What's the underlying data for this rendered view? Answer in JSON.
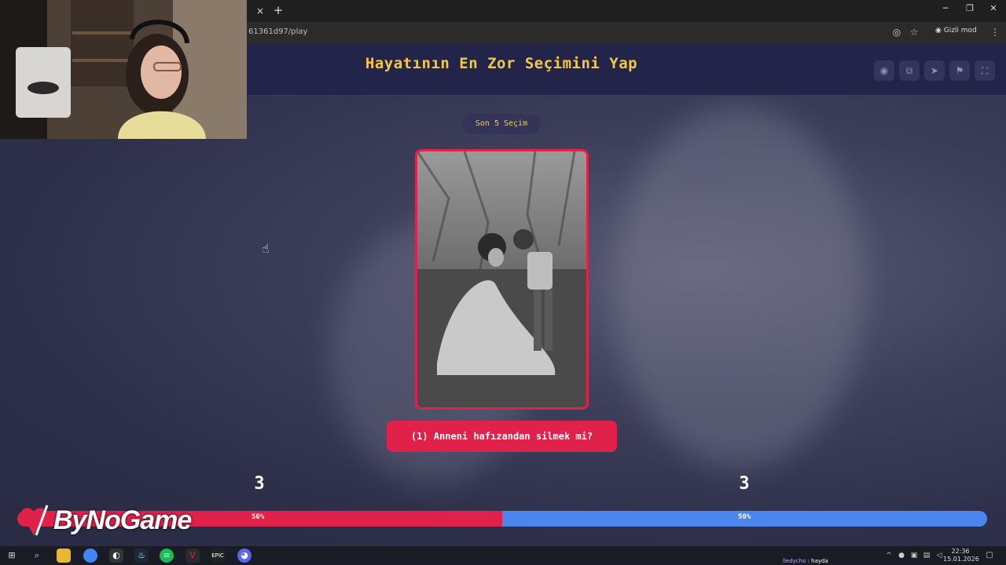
{
  "browser": {
    "tab_close": "×",
    "new_tab": "+",
    "url": "61361d97/play",
    "incognito_label": "Gizli mod",
    "minimize": "─",
    "restore": "❐",
    "close": "✕"
  },
  "site": {
    "title": "Hayatının En Zor Seçimini Yap",
    "header_buttons": [
      "eye-icon",
      "copy-icon",
      "send-icon",
      "flag-icon",
      "fullscreen-icon"
    ],
    "pill_label": "Son 5 Seçim",
    "question": "(1) Anneni hafızandan silmek mi?",
    "left_count": "3",
    "right_count": "3",
    "left_percent": "50%",
    "right_percent": "50%",
    "left_fraction": 0.5,
    "colors": {
      "title": "#f5c842",
      "accent_red": "#e0214a",
      "accent_blue": "#4a86ee",
      "background": "#2a2b45"
    }
  },
  "overlay": {
    "brand": "ByNoGame"
  },
  "taskbar": {
    "chat_user": "lledycho",
    "chat_message": "hayda",
    "time": "22:36",
    "date": "15.01.2026"
  }
}
